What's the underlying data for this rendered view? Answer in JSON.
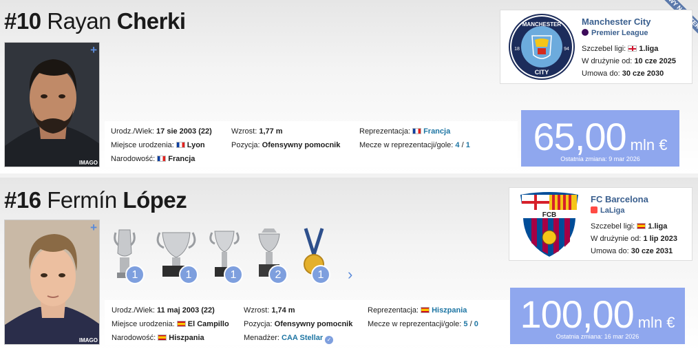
{
  "players": [
    {
      "number": "#10",
      "first_name": "Rayan",
      "last_name": "Cherki",
      "photo_plus": "+",
      "photo_credit": "IMAGO",
      "ribbon": "NOWY NABYTEK",
      "birth_label": "Urodz./Wiek:",
      "birth_value": "17 sie 2003 (22)",
      "birthplace_label": "Miejsce urodzenia:",
      "birthplace_value": "Lyon",
      "birthplace_flag": "fr",
      "citizenship_label": "Narodowość:",
      "citizenship_value": "Francja",
      "height_label": "Wzrost:",
      "height_value": "1,77 m",
      "position_label": "Pozycja:",
      "position_value": "Ofensywny pomocnik",
      "national_label": "Reprezentacja:",
      "national_value": "Francja",
      "caps_label": "Mecze w reprezentacji/gole:",
      "caps_value": "4",
      "goals_value": "1",
      "club": {
        "name": "Manchester City",
        "league": "Premier League",
        "level_label": "Szczebel ligi:",
        "level_value": "1.liga",
        "joined_label": "W drużynie od:",
        "joined_value": "10 cze 2025",
        "contract_label": "Umowa do:",
        "contract_value": "30 cze 2030"
      },
      "market_value": {
        "amount": "65,00",
        "unit": "mln €",
        "last_change": "Ostatnia zmiana: 9 mar 2026"
      }
    },
    {
      "number": "#16",
      "first_name": "Fermín",
      "last_name": "López",
      "photo_plus": "+",
      "photo_credit": "IMAGO",
      "birth_label": "Urodz./Wiek:",
      "birth_value": "11 maj 2003 (22)",
      "birthplace_label": "Miejsce urodzenia:",
      "birthplace_value": "El Campillo",
      "birthplace_flag": "es",
      "citizenship_label": "Narodowość:",
      "citizenship_value": "Hiszpania",
      "height_label": "Wzrost:",
      "height_value": "1,74 m",
      "position_label": "Pozycja:",
      "position_value": "Ofensywny pomocnik",
      "agent_label": "Menadżer:",
      "agent_value": "CAA Stellar",
      "national_label": "Reprezentacja:",
      "national_value": "Hiszpania",
      "caps_label": "Mecze w reprezentacji/gole:",
      "caps_value": "5",
      "goals_value": "0",
      "trophies": [
        "1",
        "1",
        "1",
        "2",
        "1"
      ],
      "club": {
        "name": "FC Barcelona",
        "league": "LaLiga",
        "level_label": "Szczebel ligi:",
        "level_value": "1.liga",
        "joined_label": "W drużynie od:",
        "joined_value": "1 lip 2023",
        "contract_label": "Umowa do:",
        "contract_value": "30 cze 2031"
      },
      "market_value": {
        "amount": "100,00",
        "unit": "mln €",
        "last_change": "Ostatnia zmiana: 16 mar 2026"
      }
    }
  ],
  "colors": {
    "value_box": "#8fa7ee",
    "club_name": "#3a5f8e",
    "link": "#1d75a3",
    "trophy_badge": "#7e9fde"
  },
  "icons": [
    "plus-icon",
    "france-flag-icon",
    "spain-flag-icon",
    "england-flag-icon",
    "premier-league-icon",
    "laliga-icon",
    "chevron-right-icon",
    "verified-icon"
  ],
  "crest_text": {
    "man_city_top": "MANCHESTER",
    "man_city_bottom": "CITY",
    "man_city_left": "18",
    "man_city_right": "94",
    "barca": "FCB"
  }
}
